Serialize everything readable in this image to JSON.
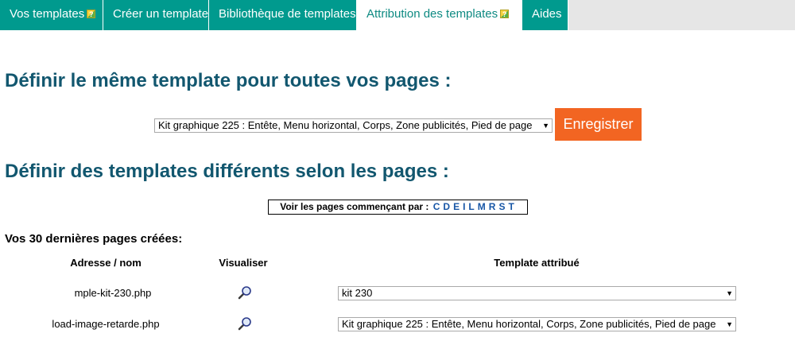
{
  "tabs": [
    {
      "label": "Vos templates",
      "help": true
    },
    {
      "label": "Créer un template",
      "help": false
    },
    {
      "label": "Bibliothèque de templates",
      "help": false
    },
    {
      "label": "Attribution des templates",
      "help": true
    },
    {
      "label": "Aides",
      "help": false
    }
  ],
  "help_icon_glyph": "?",
  "same_template": {
    "heading": "Définir le même template pour toutes vos pages :",
    "selected": "Kit graphique 225 : Entête, Menu horizontal, Corps, Zone publicités, Pied de page",
    "save_label": "Enregistrer"
  },
  "per_page": {
    "heading": "Définir des templates différents selon les pages :",
    "letters_prefix": "Voir les pages commençant par :",
    "letters": [
      "C",
      "D",
      "E",
      "I",
      "L",
      "M",
      "R",
      "S",
      "T"
    ]
  },
  "recent": {
    "title": "Vos 30 dernières pages créées:",
    "columns": [
      "Adresse / nom",
      "Visualiser",
      "Template attribué"
    ],
    "rows": [
      {
        "address": "mple-kit-230.php",
        "template": "kit 230"
      },
      {
        "address": "load-image-retarde.php",
        "template": "Kit graphique 225 : Entête, Menu horizontal, Corps, Zone publicités, Pied de page"
      }
    ]
  },
  "colors": {
    "tab_bg": "#009a8e",
    "heading": "#12576f",
    "button": "#f26522",
    "letter_link": "#1756a6"
  },
  "icons": {
    "help": "help-icon",
    "view": "magnifier-icon",
    "dropdown": "chevron-down-icon"
  }
}
